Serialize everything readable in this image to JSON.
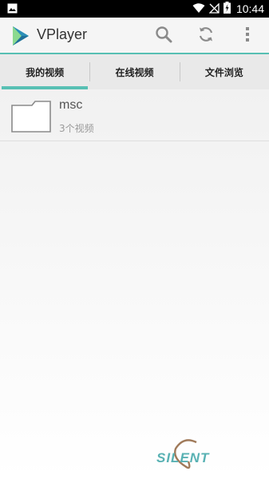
{
  "status_bar": {
    "time": "10:44"
  },
  "app_bar": {
    "title": "VPlayer",
    "actions": [
      "search-icon",
      "refresh-icon",
      "more-vert-icon"
    ]
  },
  "tabs": [
    {
      "label": "我的视频",
      "selected": true
    },
    {
      "label": "在线视频",
      "selected": false
    },
    {
      "label": "文件浏览",
      "selected": false
    }
  ],
  "folders": [
    {
      "name": "msc",
      "count": "3个视频"
    }
  ],
  "watermark": {
    "text": "SILENT"
  },
  "colors": {
    "accent": "#58c0b4",
    "tab_bg": "#e9e9e9",
    "app_bar_bg": "#f5f5f5"
  }
}
